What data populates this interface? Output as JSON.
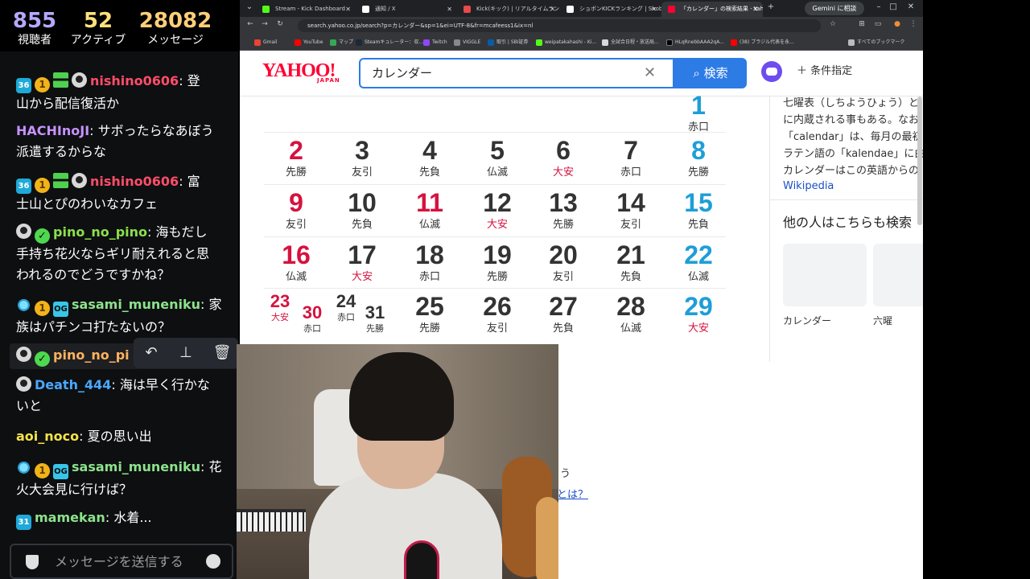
{
  "stats": {
    "viewers": "855",
    "viewers_label": "視聴者",
    "active": "52",
    "active_label": "アクティブ",
    "messages": "28082",
    "messages_label": "メッセージ"
  },
  "chat": {
    "messages": [
      {
        "user": "nishino0606",
        "sep": ": ",
        "text1": "登",
        "text2": "山から配信復活か"
      },
      {
        "user": "HACHInoJI",
        "sep": ": ",
        "text1": "サボったらなあぼう",
        "text2": "派遣するからな"
      },
      {
        "user": "nishino0606",
        "sep": ": ",
        "text1": "富",
        "text2": "士山とぴのわいなカフェ"
      },
      {
        "user": "pino_no_pino",
        "sep": ": ",
        "text1": "海もだし",
        "text2": "手持ち花火ならギリ耐えれると思",
        "text3": "われるのでどうですかね？"
      },
      {
        "user": "sasami_muneniku",
        "sep": ": ",
        "text1": "家",
        "text2": "族はパチンコ打たないの？"
      },
      {
        "user": "pino_no_pi"
      },
      {
        "user": "Death_444",
        "sep": ": ",
        "text1": "海は早く行かな",
        "text2": "いと"
      },
      {
        "user": "aoi_noco",
        "sep": ": ",
        "text1": "夏の思い出"
      },
      {
        "user": "sasami_muneniku",
        "sep": ": ",
        "text1": "花",
        "text2": "火大会見に行けば？"
      },
      {
        "user": "mamekan",
        "sep": ": ",
        "text1": "水着..."
      }
    ],
    "badges": {
      "sub36": "36",
      "sub31": "31",
      "one": "1",
      "og": "OG",
      "verified": "✓"
    },
    "actions": {
      "reply": "↶",
      "pin": "⊥",
      "delete": "🗑"
    },
    "input_placeholder": "メッセージを送信する"
  },
  "browser": {
    "tabs": [
      {
        "label": "Stream - Kick Dashboard",
        "color": "#53fc18"
      },
      {
        "label": "通知 / X",
        "color": "#ffffff"
      },
      {
        "label": "Kick(キック) | リアルタイムランキング",
        "color": "#e64a4a"
      },
      {
        "label": "ショボンKICKランキング | Shobon Ki",
        "color": "#ffffff"
      },
      {
        "label": "「カレンダー」の検索結果 - Yahoo!検",
        "color": "#ff0033"
      }
    ],
    "new_tab": "+",
    "gemini_label": "Gemini に相談",
    "url": "search.yahoo.co.jp/search?p=カレンダー&sp=1&ei=UTF-8&fr=mcafeess1&ix=nl",
    "bookmarks": [
      "Gmail",
      "YouTube",
      "マップ",
      "Steamキュレーター：収...",
      "Twitch",
      "VIGGLE",
      "取引 | SBI証券",
      "weipatakahashi - Ki...",
      "全試合日程・放送局...",
      "HLqRnebbAAA2qA...",
      "(38) ブラジル代表を永..."
    ],
    "bookmarks_all": "すべてのブックマーク"
  },
  "yahoo": {
    "logo": "YAHOO!",
    "logo_sub": "JAPAN",
    "query": "カレンダー",
    "clear": "✕",
    "search_button": "検索",
    "search_icon": "⌕",
    "conditions": "＋ 条件指定"
  },
  "calendar": {
    "top": {
      "day": "1",
      "rokuyo": "赤口"
    },
    "rows": [
      [
        {
          "d": "2",
          "r": "先勝",
          "k": "sun"
        },
        {
          "d": "3",
          "r": "友引"
        },
        {
          "d": "4",
          "r": "先負"
        },
        {
          "d": "5",
          "r": "仏滅"
        },
        {
          "d": "6",
          "r": "大安",
          "t": 1
        },
        {
          "d": "7",
          "r": "赤口"
        },
        {
          "d": "8",
          "r": "先勝",
          "k": "sat"
        }
      ],
      [
        {
          "d": "9",
          "r": "友引",
          "k": "sun"
        },
        {
          "d": "10",
          "r": "先負"
        },
        {
          "d": "11",
          "r": "仏滅",
          "k": "sun"
        },
        {
          "d": "12",
          "r": "大安",
          "t": 1
        },
        {
          "d": "13",
          "r": "先勝"
        },
        {
          "d": "14",
          "r": "友引"
        },
        {
          "d": "15",
          "r": "先負",
          "k": "sat"
        }
      ],
      [
        {
          "d": "16",
          "r": "仏滅",
          "k": "sun"
        },
        {
          "d": "17",
          "r": "大安",
          "t": 1
        },
        {
          "d": "18",
          "r": "赤口"
        },
        {
          "d": "19",
          "r": "先勝"
        },
        {
          "d": "20",
          "r": "友引"
        },
        {
          "d": "21",
          "r": "先負"
        },
        {
          "d": "22",
          "r": "仏滅",
          "k": "sat"
        }
      ],
      [
        {
          "d": "25",
          "r": "先勝"
        },
        {
          "d": "26",
          "r": "友引"
        },
        {
          "d": "27",
          "r": "先負"
        },
        {
          "d": "28",
          "r": "仏滅"
        },
        {
          "d": "29",
          "r": "大安",
          "k": "sat",
          "t": 1
        }
      ]
    ],
    "split": [
      {
        "d": "23",
        "r": "大安",
        "k": "sun",
        "t": 1
      },
      {
        "d": "30",
        "r": "赤口",
        "k": "sun"
      },
      {
        "d": "24",
        "r": "赤口"
      },
      {
        "d": "31",
        "r": "先勝"
      }
    ]
  },
  "knowledge": {
    "lines": [
      "七曜表（しちようひょう）と",
      "に内蔵される事もある。なお",
      "「calendar」は、毎月の最初",
      "ラテン語の「kalendae」に由",
      "カレンダーはこの英語からの"
    ],
    "source": "Wikipedia",
    "related_heading": "他の人はこちらも検索",
    "related": [
      "カレンダー",
      "六曜"
    ]
  },
  "fragments": {
    "text": "う",
    "link": "とは？"
  }
}
